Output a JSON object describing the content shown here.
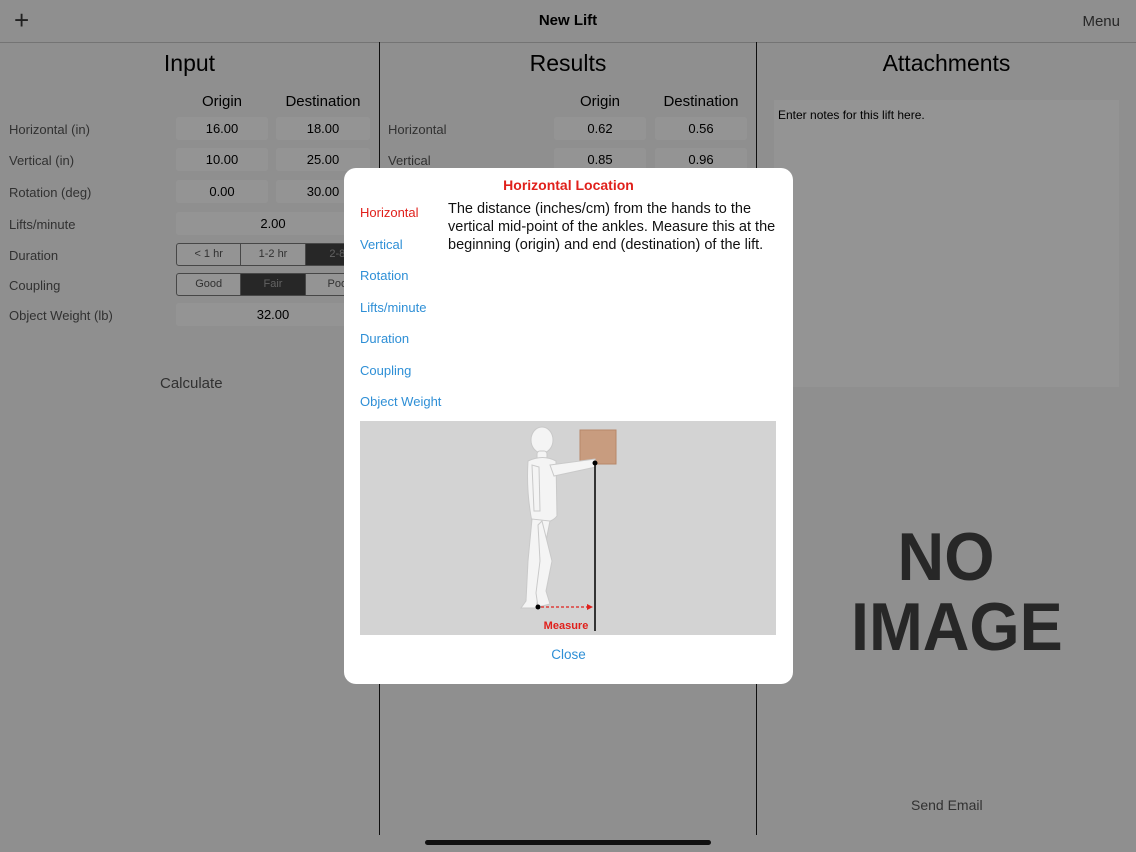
{
  "nav": {
    "title": "New Lift",
    "menu": "Menu",
    "add_icon": "+"
  },
  "input": {
    "title": "Input",
    "col_origin": "Origin",
    "col_destination": "Destination",
    "rows": {
      "horizontal": {
        "label": "Horizontal (in)",
        "origin": "16.00",
        "destination": "18.00"
      },
      "vertical": {
        "label": "Vertical (in)",
        "origin": "10.00",
        "destination": "25.00"
      },
      "rotation": {
        "label": "Rotation (deg)",
        "origin": "0.00",
        "destination": "30.00"
      },
      "lifts": {
        "label": "Lifts/minute",
        "value": "2.00"
      },
      "duration": {
        "label": "Duration",
        "options": [
          "< 1 hr",
          "1-2 hr",
          "2-8"
        ],
        "selected": "2-8"
      },
      "coupling": {
        "label": "Coupling",
        "options": [
          "Good",
          "Fair",
          "Poo"
        ],
        "selected": "Fair"
      },
      "weight": {
        "label": "Object Weight (lb)",
        "value": "32.00"
      }
    },
    "calculate": "Calculate"
  },
  "results": {
    "title": "Results",
    "col_origin": "Origin",
    "col_destination": "Destination",
    "rows": {
      "horizontal": {
        "label": "Horizontal",
        "origin": "0.62",
        "destination": "0.56"
      },
      "vertical": {
        "label": "Vertical",
        "origin": "0.85",
        "destination": "0.96"
      }
    }
  },
  "attachments": {
    "title": "Attachments",
    "notes_placeholder": "Enter notes for this lift here.",
    "no_image_line1": "NO",
    "no_image_line2": "IMAGE",
    "send_email": "Send Email"
  },
  "dialog": {
    "title": "Horizontal Location",
    "nav": [
      "Horizontal",
      "Vertical",
      "Rotation",
      "Lifts/minute",
      "Duration",
      "Coupling",
      "Object Weight"
    ],
    "active": "Horizontal",
    "description": "The distance (inches/cm) from the hands to the vertical mid-point of the ankles. Measure this at the beginning (origin) and end (destination) of the lift.",
    "figure_label": "Measure",
    "close": "Close"
  },
  "colors": {
    "accent_red": "#e0201b",
    "link_blue": "#2e8fd6"
  }
}
